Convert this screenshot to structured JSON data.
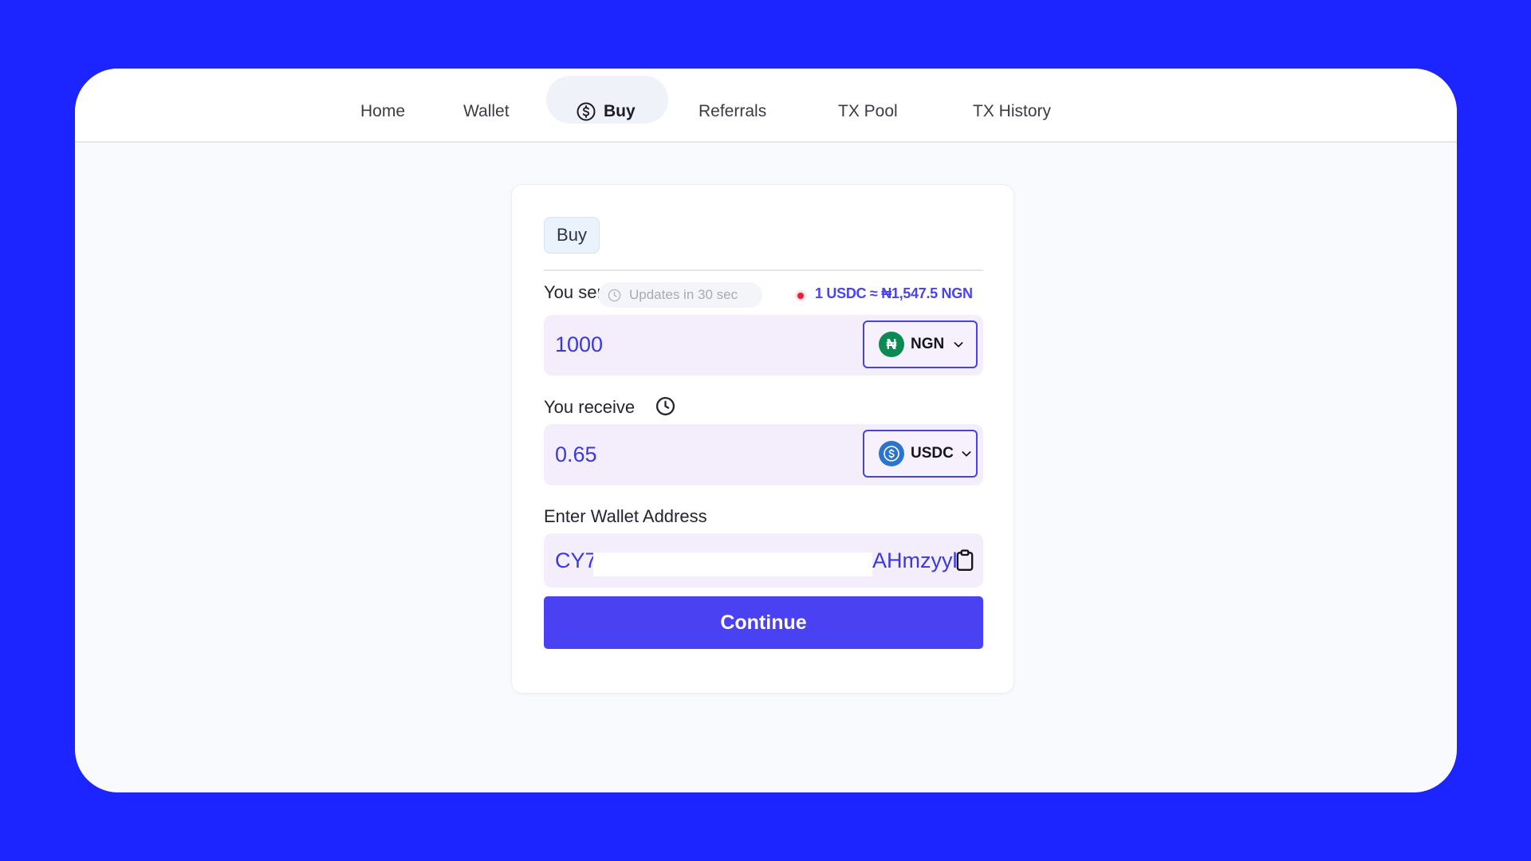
{
  "nav": {
    "home": "Home",
    "wallet": "Wallet",
    "buy": "Buy",
    "referrals": "Referrals",
    "tx_pool": "TX Pool",
    "tx_history": "TX History",
    "active": "Buy"
  },
  "card": {
    "chip": "Buy",
    "send": {
      "label": "You send",
      "updates": "Updates in 30 sec",
      "rate": "1 USDC ≈ ₦1,547.5 NGN",
      "value": "1000",
      "currency": "NGN",
      "currency_symbol": "₦"
    },
    "receive": {
      "label": "You receive",
      "value": "0.65",
      "currency": "USDC"
    },
    "wallet": {
      "label": "Enter Wallet Address",
      "value_start": "CY7",
      "value_end": "AHmzyyl"
    },
    "continue_label": "Continue"
  },
  "colors": {
    "background": "#1c24ff",
    "accent": "#4a41f3",
    "field_bg": "#f4eefc",
    "ngn_coin": "#0c8a53",
    "usdc_coin": "#2b74ce",
    "live_dot": "#ee1c3b"
  },
  "icons": [
    "dollar-circle-icon",
    "clock-icon",
    "live-dot-icon",
    "naira-coin-icon",
    "usdc-coin-icon",
    "chevron-down-icon",
    "clipboard-icon"
  ]
}
